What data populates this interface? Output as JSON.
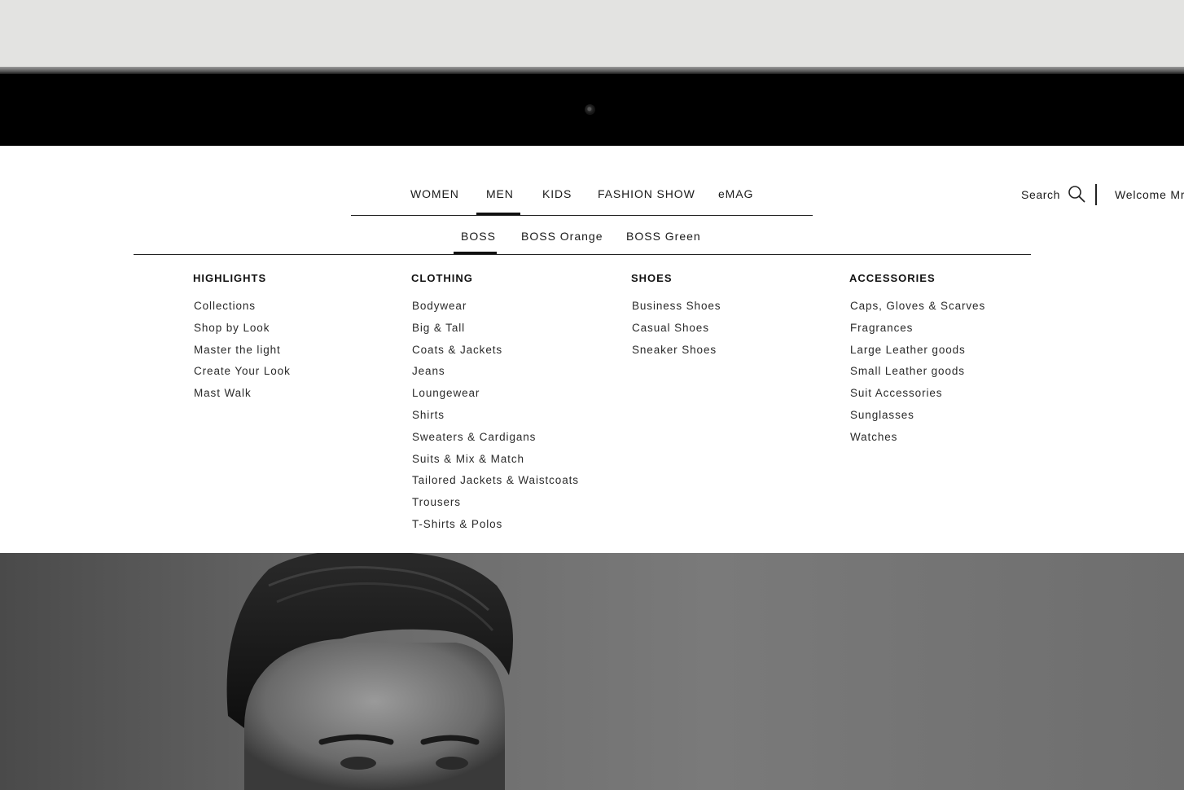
{
  "main_nav": {
    "items": [
      {
        "label": "WOMEN"
      },
      {
        "label": "MEN"
      },
      {
        "label": "KIDS"
      },
      {
        "label": "FASHION SHOW"
      },
      {
        "label": "eMAG"
      }
    ],
    "active": "MEN"
  },
  "header": {
    "search_label": "Search",
    "welcome_text": "Welcome Mr"
  },
  "sub_nav": {
    "items": [
      {
        "label": "BOSS"
      },
      {
        "label": "BOSS Orange"
      },
      {
        "label": "BOSS Green"
      }
    ],
    "active": "BOSS"
  },
  "menu": {
    "highlights": {
      "title": "HIGHLIGHTS",
      "items": [
        "Collections",
        "Shop by Look",
        "Master the light",
        "Create Your Look",
        "Mast Walk"
      ]
    },
    "clothing": {
      "title": "CLOTHING",
      "items": [
        "Bodywear",
        "Big & Tall",
        "Coats & Jackets",
        "Jeans",
        "Loungewear",
        "Shirts",
        "Sweaters & Cardigans",
        "Suits & Mix & Match",
        "Tailored Jackets & Waistcoats",
        "Trousers",
        "T-Shirts & Polos"
      ]
    },
    "shoes": {
      "title": "SHOES",
      "items": [
        "Business Shoes",
        "Casual Shoes",
        "Sneaker Shoes"
      ]
    },
    "accessories": {
      "title": "ACCESSORIES",
      "items": [
        "Caps, Gloves & Scarves",
        "Fragrances",
        "Large Leather goods",
        "Small Leather goods",
        "Suit Accessories",
        "Sunglasses",
        "Watches"
      ]
    }
  },
  "colors": {
    "text": "#1a1a1a",
    "accent": "#111111",
    "background": "#ffffff",
    "bezel": "#000000"
  },
  "icons": [
    "search-icon",
    "camera-icon"
  ]
}
